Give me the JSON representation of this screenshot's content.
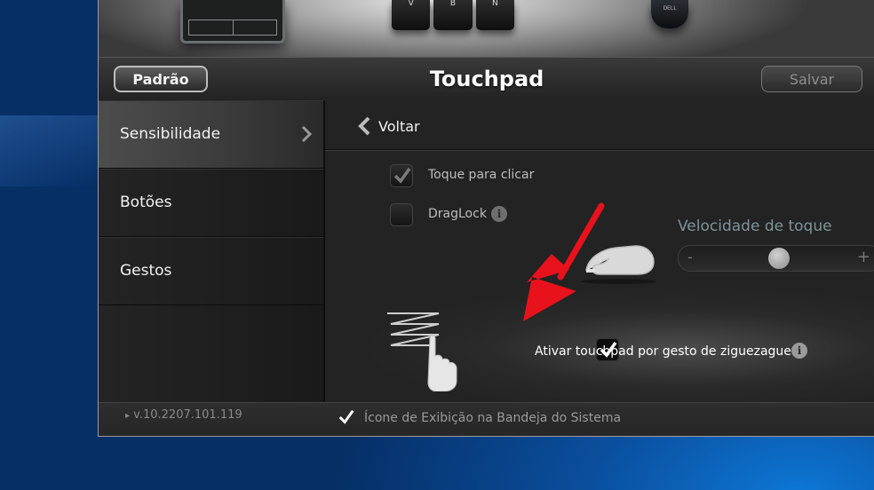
{
  "window": {
    "title": "Touchpad"
  },
  "toolbar": {
    "default_label": "Padrão",
    "save_label": "Salvar"
  },
  "devices": {
    "keys": [
      "V",
      "B",
      "N"
    ],
    "mouse_brand": "DELL"
  },
  "sidebar": {
    "items": [
      {
        "label": "Sensibilidade",
        "active": true
      },
      {
        "label": "Botões",
        "active": false
      },
      {
        "label": "Gestos",
        "active": false
      }
    ]
  },
  "content": {
    "back_label": "Voltar",
    "options": [
      {
        "label": "Toque para clicar",
        "checked": true,
        "enabled": false
      },
      {
        "label": "DragLock",
        "checked": false,
        "enabled": false,
        "info": true
      },
      {
        "label": "Ativar touchpad por gesto de ziguezague",
        "checked": true,
        "enabled": true,
        "info": true
      }
    ],
    "speed": {
      "title": "Velocidade de toque",
      "minus": "-",
      "plus": "+",
      "level": 0.5
    }
  },
  "footer": {
    "version": "v.10.2207.101.119",
    "tray_label": "Ícone de Exibição na Bandeja do Sistema",
    "tray_checked": true
  },
  "colors": {
    "annotation_arrow": "#e8121c",
    "speed_title": "#7f939c"
  }
}
